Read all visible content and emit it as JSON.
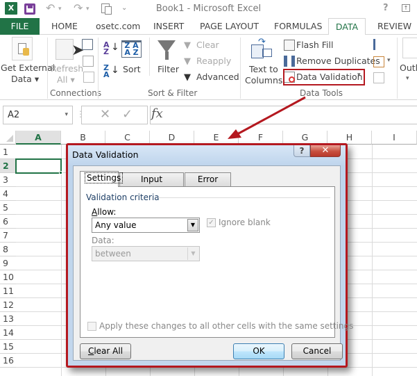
{
  "window": {
    "title": "Book1 - Microsoft Excel",
    "app_logo": "X",
    "help_glyph": "?",
    "restore_glyph": "↑"
  },
  "quick_access": {
    "undo_glyph": "↶",
    "redo_glyph": "↷",
    "more_glyph": "⌄"
  },
  "ribbon_tabs": [
    {
      "label": "FILE"
    },
    {
      "label": "HOME"
    },
    {
      "label": "osetc.com"
    },
    {
      "label": "INSERT"
    },
    {
      "label": "PAGE LAYOUT"
    },
    {
      "label": "FORMULAS"
    },
    {
      "label": "DATA"
    },
    {
      "label": "REVIEW"
    }
  ],
  "active_tab": "DATA",
  "ribbon": {
    "get_external": {
      "line1": "Get External",
      "line2": "Data ▾"
    },
    "connections": {
      "refresh_line1": "Refresh",
      "refresh_line2": "All ▾",
      "group_label": "Connections"
    },
    "sort_filter": {
      "az": "A↓Z",
      "za": "Z↓A",
      "sort_label": "Sort",
      "filter_label": "Filter",
      "clear_label": "Clear",
      "reapply_label": "Reapply",
      "advanced_label": "Advanced",
      "group_label": "Sort & Filter"
    },
    "data_tools": {
      "text_to_columns_line1": "Text to",
      "text_to_columns_line2": "Columns",
      "flash_fill_label": "Flash Fill",
      "remove_duplicates_label": "Remove Duplicates",
      "data_validation_label": "Data Validation",
      "dropdown_glyph": "▾",
      "group_label": "Data Tools"
    },
    "outline": {
      "label": "Outli",
      "caret": "▾"
    }
  },
  "formula_bar": {
    "name_box": "A2",
    "name_caret": "▾",
    "cancel_glyph": "✕",
    "enter_glyph": "✓",
    "fx_glyph": "fx",
    "formula_value": ""
  },
  "sheet": {
    "columns": [
      "A",
      "B",
      "C",
      "D",
      "E",
      "F",
      "G",
      "H",
      "I"
    ],
    "rows": [
      "1",
      "2",
      "3",
      "4",
      "5",
      "6",
      "7",
      "8",
      "9",
      "10",
      "11",
      "12",
      "13",
      "14",
      "15",
      "16"
    ],
    "selected_cell": "A2"
  },
  "dialog": {
    "title": "Data Validation",
    "help_glyph": "?",
    "close_glyph": "✕",
    "tabs": [
      {
        "label": "Settings"
      },
      {
        "label": "Input Message"
      },
      {
        "label": "Error Alert"
      }
    ],
    "active_tab": "Settings",
    "criteria_label": "Validation criteria",
    "allow_label": "Allow:",
    "allow_value": "Any value",
    "ignore_blank_label": "Ignore blank",
    "ignore_blank_checked": true,
    "check_glyph": "✓",
    "data_label": "Data:",
    "data_value": "between",
    "dropdown_glyph": "▼",
    "apply_label": "Apply these changes to all other cells with the same settings",
    "apply_checked": false,
    "buttons": {
      "clear_all": "Clear All",
      "ok": "OK",
      "cancel": "Cancel"
    }
  },
  "annotation": {
    "color": "#b4181f"
  }
}
